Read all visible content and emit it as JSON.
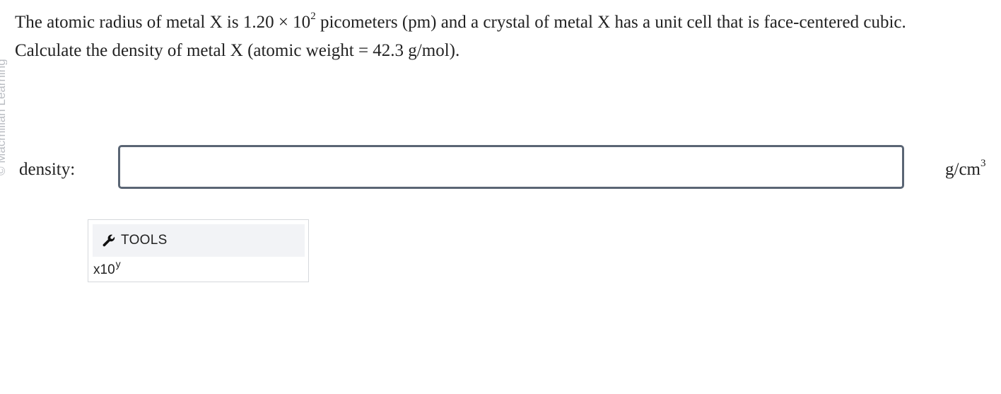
{
  "watermark": {
    "text": "© Macmillan Learning"
  },
  "question": {
    "line1_before": "The atomic radius of metal X is 1.20 × 10",
    "line1_exp": "2",
    "line1_after": " picometers (pm) and a crystal of metal X has a unit cell that is face-centered cubic.",
    "line2": "Calculate the density of metal X (atomic weight = 42.3 g/mol)."
  },
  "answer": {
    "label": "density:",
    "value": "",
    "placeholder": "",
    "unit_base": "g/cm",
    "unit_exp": "3"
  },
  "tools": {
    "icon": "wrench-icon",
    "label": "TOOLS",
    "x10_base": "x10",
    "x10_exp": "y"
  }
}
